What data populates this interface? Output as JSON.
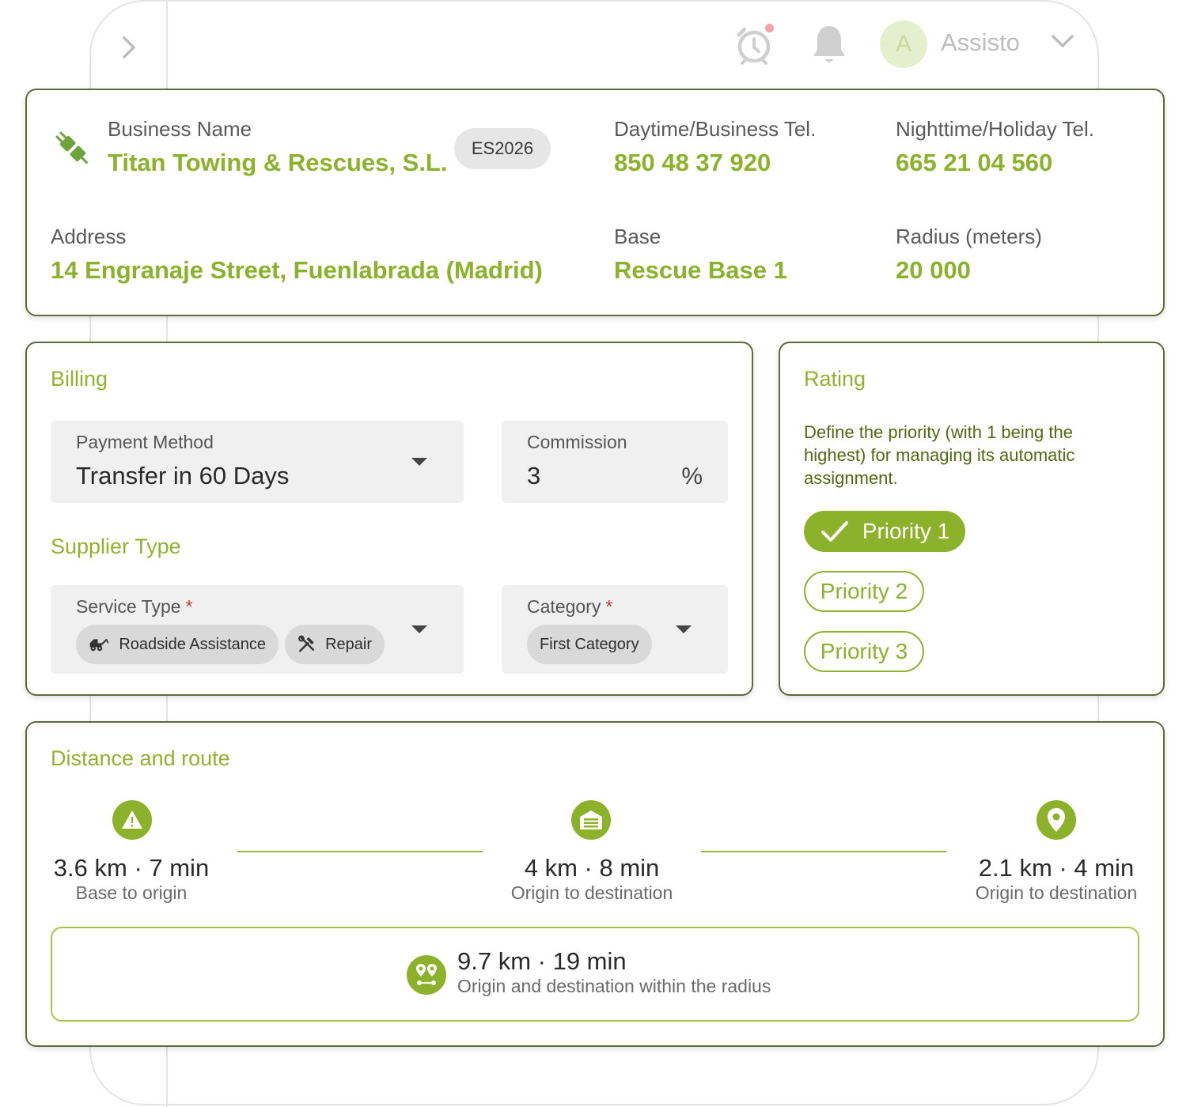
{
  "topbar": {
    "user_initial": "A",
    "user_name": "Assisto",
    "icons": [
      "chevron-right-icon",
      "alarm-clock-icon",
      "bell-icon",
      "chevron-down-icon"
    ]
  },
  "supplier": {
    "business_name_label": "Business Name",
    "business_name": "Titan Towing & Rescues, S.L.",
    "code": "ES2026",
    "day_tel_label": "Daytime/Business Tel.",
    "day_tel": "850 48 37 920",
    "night_tel_label": "Nighttime/Holiday Tel.",
    "night_tel": "665 21 04 560",
    "address_label": "Address",
    "address": "14 Engranaje Street, Fuenlabrada (Madrid)",
    "base_label": "Base",
    "base": "Rescue Base 1",
    "radius_label": "Radius (meters)",
    "radius": "20 000"
  },
  "billing": {
    "title": "Billing",
    "payment_method_label": "Payment Method",
    "payment_method_value": "Transfer in 60 Days",
    "commission_label": "Commission",
    "commission_value": "3",
    "commission_unit": "%"
  },
  "supplier_type": {
    "title": "Supplier Type",
    "service_type_label": "Service Type",
    "service_type_chips": [
      "Roadside Assistance",
      "Repair"
    ],
    "category_label": "Category",
    "category_chips": [
      "First Category"
    ],
    "required_mark": "*"
  },
  "rating": {
    "title": "Rating",
    "description": "Define the priority (with 1 being the highest) for managing its automatic assignment.",
    "priorities": [
      "Priority 1",
      "Priority 2",
      "Priority 3"
    ],
    "selected": "Priority 1"
  },
  "route": {
    "title": "Distance and route",
    "legs": [
      {
        "main": "3.6 km · 7 min",
        "sub": "Base to origin",
        "icon": "warning-triangle-icon"
      },
      {
        "main": "4 km · 8 min",
        "sub": "Origin to destination",
        "icon": "garage-icon"
      },
      {
        "main": "2.1 km · 4 min",
        "sub": "Origin to destination",
        "icon": "map-pin-icon"
      }
    ],
    "total_main": "9.7 km · 19 min",
    "total_sub": "Origin and destination within the radius",
    "total_icon": "route-pins-icon"
  },
  "colors": {
    "accent": "#8cb12a",
    "card_border": "#5e6a39",
    "required": "#c63a3a",
    "field_bg": "#f0f0f0"
  }
}
